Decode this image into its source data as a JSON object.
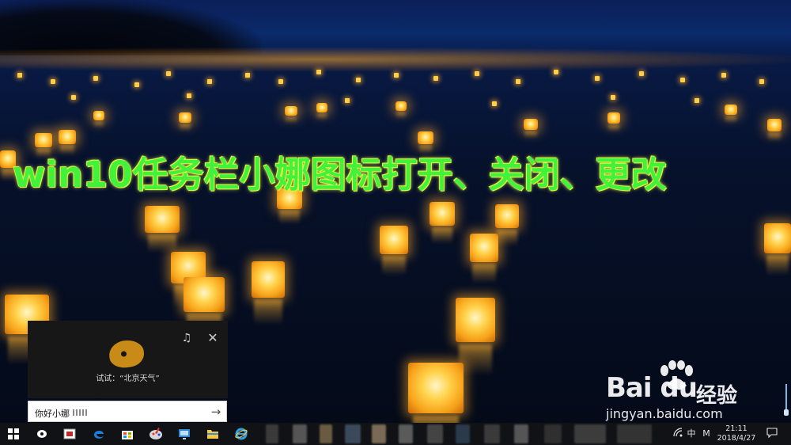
{
  "headline": "win10任务栏小娜图标打开、关闭、更改",
  "cortana": {
    "hint": "试试：“北京天气”",
    "notes_icon": "music-notes-icon",
    "close_icon": "close-icon"
  },
  "search": {
    "text": "你好小娜",
    "submit_icon": "arrow-right-icon"
  },
  "watermark": {
    "brand": "Bai du",
    "brand_cn": "经验",
    "url": "jingyan.baidu.com"
  },
  "taskbar": {
    "pinned": [
      "windows-start-icon",
      "cortana-icon",
      "task-view-icon",
      "edge-icon",
      "store-icon",
      "paint-icon",
      "remote-desktop-icon",
      "file-explorer-icon",
      "internet-explorer-icon"
    ],
    "tray": {
      "network_icon": "network-icon",
      "ime_label": "中",
      "ime_mode": "M",
      "time": "21:11",
      "date": "2018/4/27",
      "notification_icon": "action-center-icon"
    }
  },
  "colors": {
    "headline": "#42f23a",
    "taskbar": "#101215",
    "cortana_panel": "#171717",
    "cortana_avatar": "#c88b17"
  }
}
